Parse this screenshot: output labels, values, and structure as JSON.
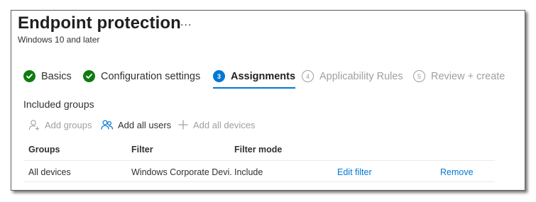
{
  "header": {
    "title": "Endpoint protection",
    "more": "...",
    "subtitle": "Windows 10 and later"
  },
  "steps": [
    {
      "number": "1",
      "label": "Basics",
      "state": "done"
    },
    {
      "number": "2",
      "label": "Configuration settings",
      "state": "done"
    },
    {
      "number": "3",
      "label": "Assignments",
      "state": "current"
    },
    {
      "number": "4",
      "label": "Applicability Rules",
      "state": "future"
    },
    {
      "number": "5",
      "label": "Review + create",
      "state": "future"
    }
  ],
  "included_groups": {
    "title": "Included groups",
    "actions": {
      "add_groups": "Add groups",
      "add_all_users": "Add all users",
      "add_all_devices": "Add all devices"
    },
    "columns": [
      "Groups",
      "Filter",
      "Filter mode",
      "",
      ""
    ],
    "rows": [
      {
        "group": "All devices",
        "filter": "Windows Corporate Devices",
        "filter_mode": "Include",
        "edit": "Edit filter",
        "remove": "Remove"
      }
    ]
  },
  "colors": {
    "accent": "#0078d4",
    "success": "#107c10",
    "disabled": "#a19f9d"
  }
}
